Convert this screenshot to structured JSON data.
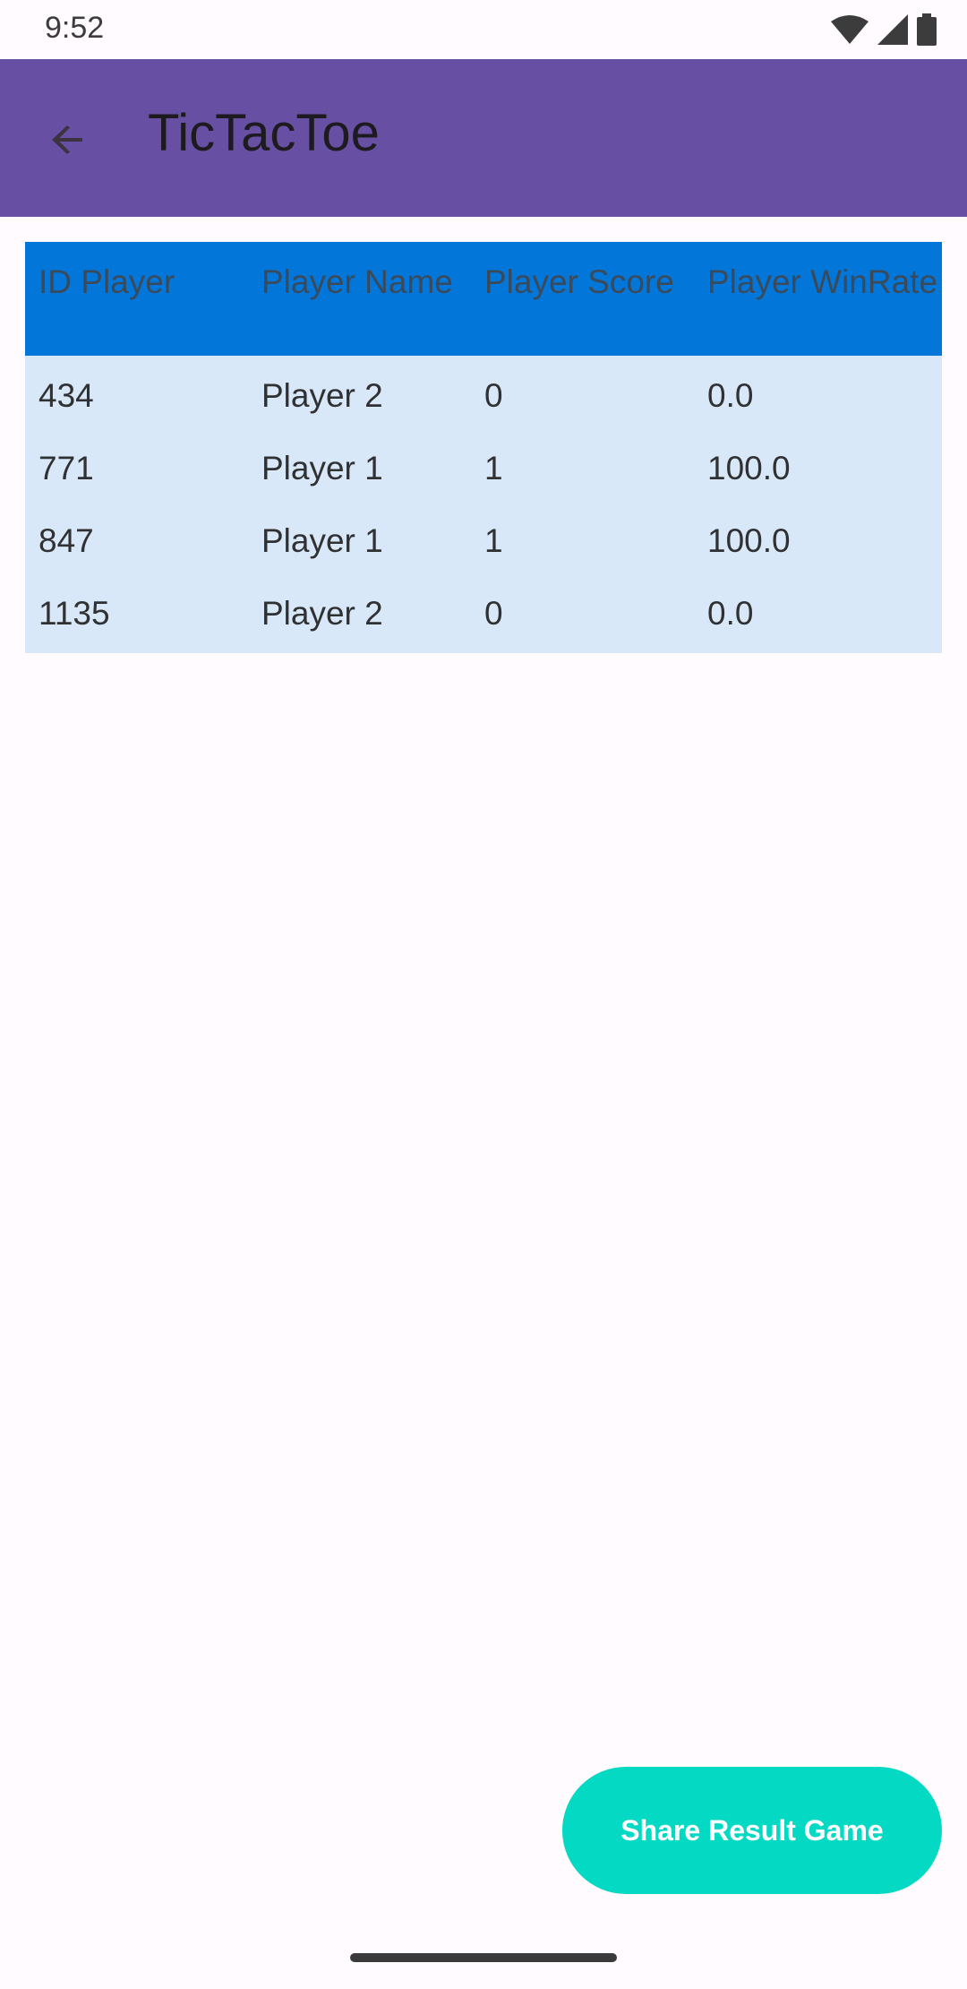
{
  "status_bar": {
    "time": "9:52",
    "icons": [
      "wifi-icon",
      "signal-icon",
      "battery-icon"
    ]
  },
  "app_bar": {
    "back_icon": "arrow-back-icon",
    "title": "TicTacToe"
  },
  "table": {
    "headers": [
      "ID Player",
      "Player Name",
      "Player Score",
      "Player WinRate"
    ],
    "rows": [
      [
        "434",
        "Player 2",
        "0",
        "0.0"
      ],
      [
        "771",
        "Player 1",
        "1",
        "100.0"
      ],
      [
        "847",
        "Player 1",
        "1",
        "100.0"
      ],
      [
        "1135",
        "Player 2",
        "0",
        "0.0"
      ]
    ]
  },
  "share_button": {
    "label": "Share Result Game"
  },
  "colors": {
    "app_bar": "#6750a4",
    "table_header": "#0277d9",
    "table_body": "#d9e8f9",
    "share_button": "#04d9c4"
  }
}
